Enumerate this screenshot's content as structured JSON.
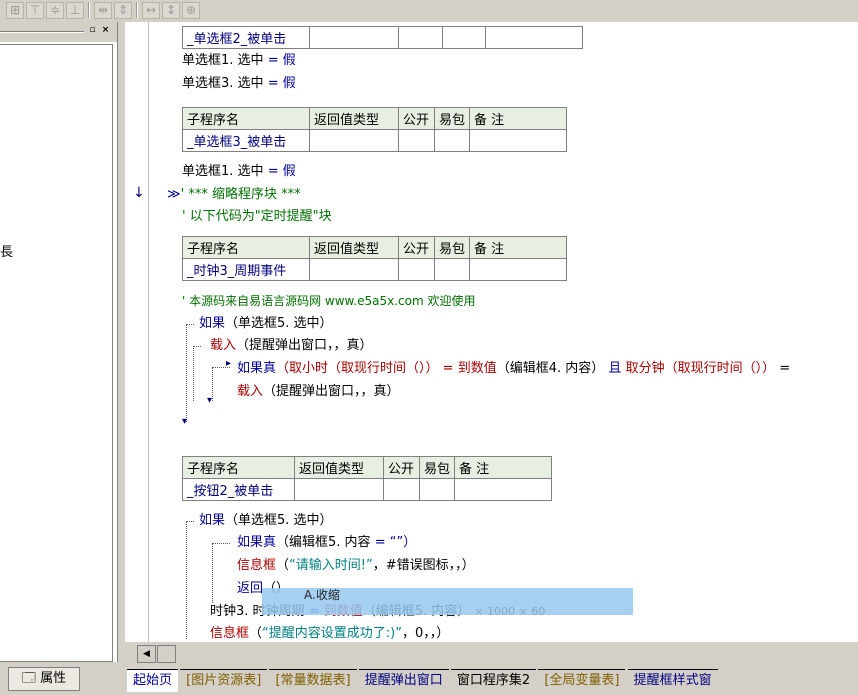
{
  "toolbar": {
    "icons": [
      "align-grid-icon",
      "align-top-icon",
      "align-middle-icon",
      "align-bottom-icon",
      "space-horizontal-icon",
      "space-vertical-icon",
      "same-width-icon",
      "same-height-icon",
      "same-size-icon"
    ]
  },
  "left_panel": {
    "edge_char": "長"
  },
  "code": {
    "table1": {
      "name": "_单选框2_被单击"
    },
    "l1": {
      "a": "单选框1. 选中",
      "eq": "=",
      "v": "假"
    },
    "l2": {
      "a": "单选框3. 选中",
      "eq": "=",
      "v": "假"
    },
    "table2": {
      "h": [
        "子程序名",
        "返回值类型",
        "公开",
        "易包",
        "备 注"
      ],
      "name": "_单选框3_被单击"
    },
    "l3": {
      "a": "单选框1. 选中",
      "eq": "=",
      "v": "假"
    },
    "l4": {
      "arrow": "↓",
      "marker": "≫",
      "text": "' *** 缩略程序块 ***"
    },
    "l5": {
      "text": "' 以下代码为\"定时提醒\"块"
    },
    "table3": {
      "h": [
        "子程序名",
        "返回值类型",
        "公开",
        "易包",
        "备 注"
      ],
      "name": "_时钟3_周期事件"
    },
    "l6": {
      "text": "' 本源码来自易语言源码网 www.e5a5x.com  欢迎使用"
    },
    "l7": {
      "kw": "如果",
      "args": "（单选框5. 选中）"
    },
    "l8": {
      "kw": "载入",
      "args": "（提醒弹出窗口，，真）"
    },
    "l9": {
      "kw": "如果真",
      "p1": "（取小时（取现行时间（））",
      "eq": "=",
      "p2": "到数值",
      "p3": "（编辑框4. 内容）",
      "and": "且",
      "p4": "取分钟（取现行时间（））",
      "p5": "="
    },
    "l10": {
      "kw": "载入",
      "args": "（提醒弹出窗口，，真）"
    },
    "table4": {
      "h": [
        "子程序名",
        "返回值类型",
        "公开",
        "易包",
        "备 注"
      ],
      "name": "_按钮2_被单击"
    },
    "l11": {
      "kw": "如果",
      "args": "（单选框5. 选中）"
    },
    "l12": {
      "kw": "如果真",
      "args": "（编辑框5. 内容",
      "eq": "=",
      "str": "“”）"
    },
    "l13": {
      "kw": "信息框",
      "p1": "（",
      "str": "“请输入时间!”",
      "p2": "，#错误图标，，）"
    },
    "l14": {
      "kw": "返回",
      "args": "（）"
    },
    "l15": {
      "a": "时钟3. 时钟周期",
      "eq": "=",
      "p1": "到数值",
      "p2": "（编辑框5. 内容）",
      "p3": "× 1000 × 60"
    },
    "l16": {
      "kw": "信息框",
      "p1": "（",
      "str": "“提醒内容设置成功了:)”",
      "p2": "，0，，）"
    }
  },
  "popup": {
    "label": "A.收缩"
  },
  "bottom": {
    "properties_label": "属性",
    "tabs": [
      "起始页",
      "[图片资源表]",
      "[常量数据表]",
      "提醒弹出窗口",
      "窗口程序集2",
      "[全局变量表]",
      "提醒框样式窗"
    ]
  }
}
